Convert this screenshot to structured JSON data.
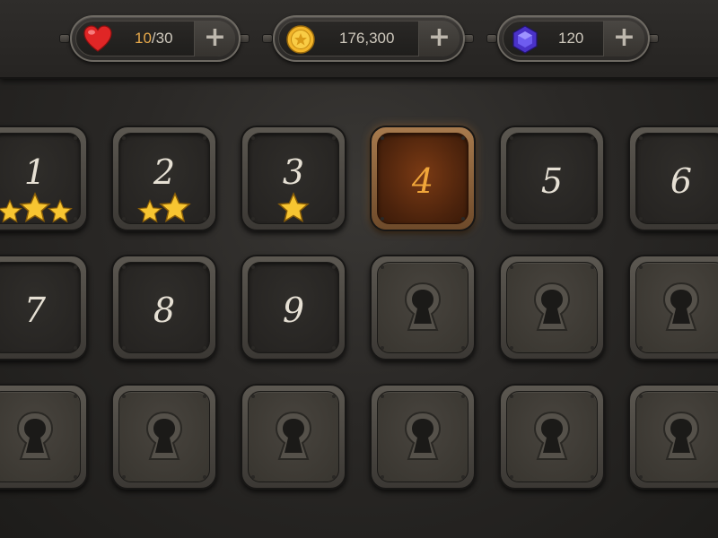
{
  "currencies": {
    "lives": {
      "current": "10",
      "separator": "/",
      "max": "30",
      "icon": "heart-icon",
      "color": "#e8a94a"
    },
    "coins": {
      "value": "176,300",
      "icon": "coin-icon"
    },
    "gems": {
      "value": "120",
      "icon": "gem-icon"
    },
    "add_symbol": "+"
  },
  "colors": {
    "current_level_accent": "#f0a63a",
    "star": "#f7c531",
    "heart": "#e02626",
    "gem": "#5a3fd8"
  },
  "levels": [
    {
      "number": "1",
      "stars": 3,
      "state": "completed"
    },
    {
      "number": "2",
      "stars": 2,
      "state": "completed"
    },
    {
      "number": "3",
      "stars": 1,
      "state": "completed"
    },
    {
      "number": "4",
      "stars": 0,
      "state": "current"
    },
    {
      "number": "5",
      "stars": 0,
      "state": "unlocked"
    },
    {
      "number": "6",
      "stars": 0,
      "state": "unlocked"
    },
    {
      "number": "7",
      "stars": 0,
      "state": "unlocked"
    },
    {
      "number": "8",
      "stars": 0,
      "state": "unlocked"
    },
    {
      "number": "9",
      "stars": 0,
      "state": "unlocked"
    },
    {
      "number": "",
      "stars": 0,
      "state": "locked"
    },
    {
      "number": "",
      "stars": 0,
      "state": "locked"
    },
    {
      "number": "",
      "stars": 0,
      "state": "locked"
    },
    {
      "number": "",
      "stars": 0,
      "state": "locked"
    },
    {
      "number": "",
      "stars": 0,
      "state": "locked"
    },
    {
      "number": "",
      "stars": 0,
      "state": "locked"
    },
    {
      "number": "",
      "stars": 0,
      "state": "locked"
    },
    {
      "number": "",
      "stars": 0,
      "state": "locked"
    },
    {
      "number": "",
      "stars": 0,
      "state": "locked"
    }
  ]
}
